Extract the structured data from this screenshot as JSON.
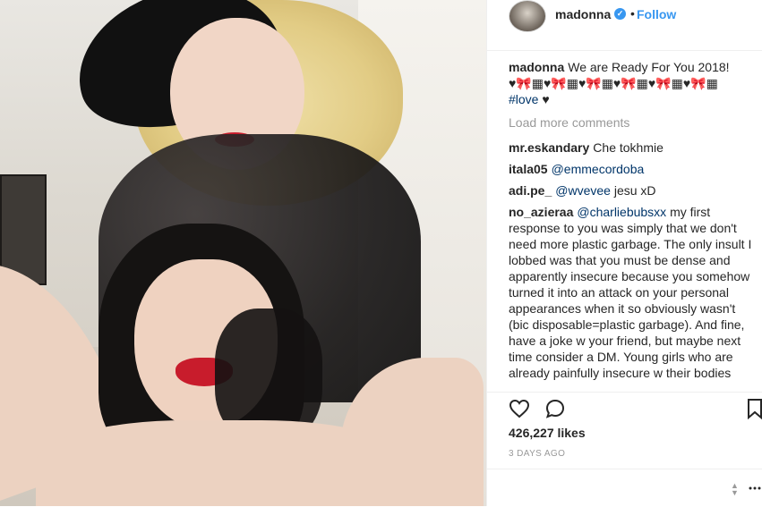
{
  "post": {
    "username": "madonna",
    "follow_label": "Follow",
    "dot": "•"
  },
  "caption": {
    "username": "madonna",
    "text": "We are Ready For You 2018!",
    "emoji_line": "♥🎀▦♥🎀▦♥🎀▦♥🎀▦♥🎀▦♥🎀▦",
    "hashtag": "#love",
    "trail": "♥"
  },
  "load_more": "Load more comments",
  "comments": [
    {
      "user": "mr.eskandary",
      "mention": "",
      "text": "Che tokhmie"
    },
    {
      "user": "itala05",
      "mention": "@emmecordoba",
      "text": ""
    },
    {
      "user": "adi.pe_",
      "mention": "@wvevee",
      "text": "jesu xD"
    },
    {
      "user": "no_azieraa",
      "mention": "@charliebubsxx",
      "text": "my first response to you was simply that we don't need more plastic garbage. The only insult I lobbed was that you must be dense and apparently insecure because you somehow turned it into an attack on your personal appearances when it so obviously wasn't (bic disposable=plastic garbage). And fine, have a joke w your friend, but maybe next time consider a DM. Young girls who are already painfully insecure w their bodies"
    }
  ],
  "likes": "426,227 likes",
  "time": "3 DAYS AGO",
  "icons": {
    "like": "heart-icon",
    "comment": "comment-icon",
    "save": "bookmark-icon",
    "verified": "verified-badge-icon"
  },
  "colors": {
    "accent": "#3897f0",
    "mention": "#003569",
    "muted": "#999999"
  }
}
